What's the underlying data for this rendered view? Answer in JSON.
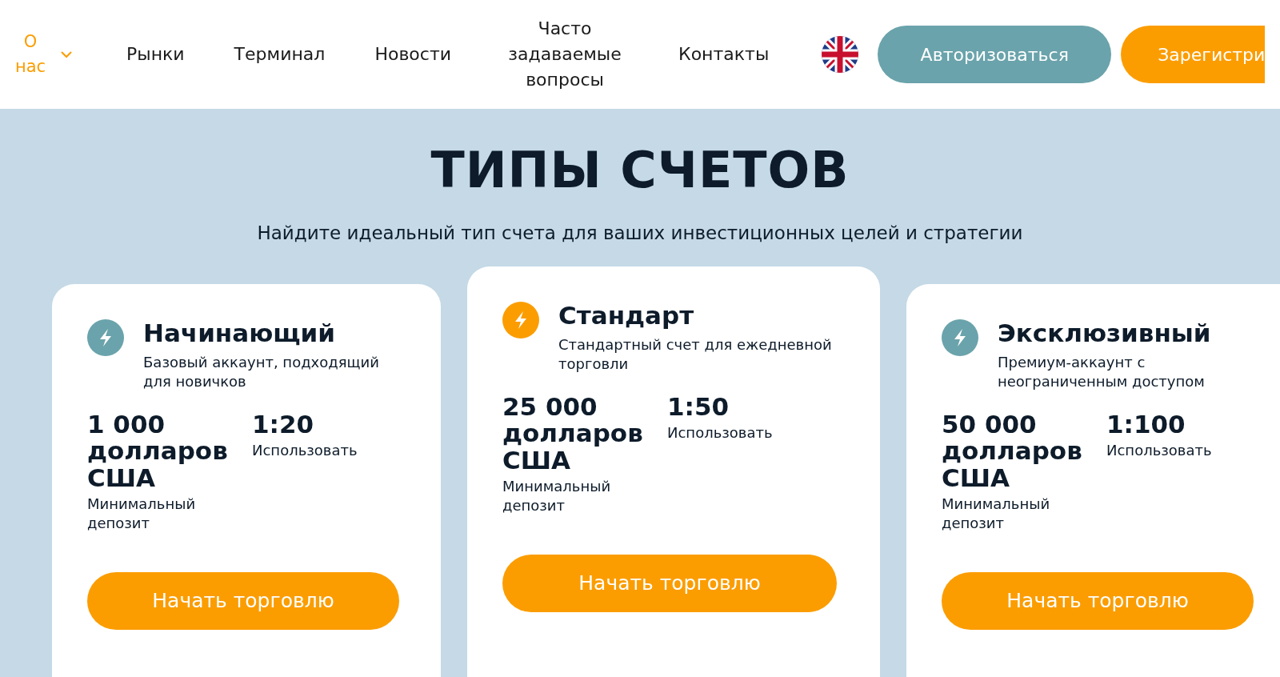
{
  "nav": {
    "about": {
      "label": "О нас"
    },
    "items": [
      {
        "label": "Рынки"
      },
      {
        "label": "Терминал"
      },
      {
        "label": "Новости"
      },
      {
        "label": "Часто задаваемые вопросы"
      },
      {
        "label": "Контакты"
      }
    ],
    "login": "Авторизоваться",
    "register": "Зарегистри"
  },
  "hero": {
    "title": "ТИПЫ СЧЕТОВ",
    "subtitle": "Найдите идеальный тип счета для ваших инвестиционных целей и стратегии"
  },
  "plans": [
    {
      "name": "Начинающий",
      "description": "Базовый аккаунт, подходящий для новичков",
      "deposit": "1 000 долларов США",
      "deposit_label": "Минимальный депозит",
      "leverage": "1:20",
      "leverage_label": "Использовать",
      "featured": false,
      "button": "Начать торговлю"
    },
    {
      "name": "Стандарт",
      "description": "Стандартный счет для ежедневной торговли",
      "deposit": "25 000 долларов США",
      "deposit_label": "Минимальный депозит",
      "leverage": "1:50",
      "leverage_label": "Использовать",
      "featured": true,
      "button": "Начать торговлю"
    },
    {
      "name": "Эксклюзивный",
      "description": "Премиум-аккаунт с неограниченным доступом",
      "deposit": "50 000 долларов США",
      "deposit_label": "Минимальный депозит",
      "leverage": "1:100",
      "leverage_label": "Использовать",
      "featured": false,
      "button": "Начать торговлю"
    }
  ]
}
